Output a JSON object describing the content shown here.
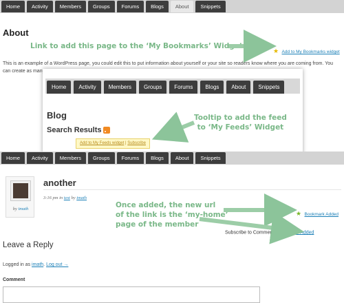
{
  "nav_tabs": [
    "Home",
    "Activity",
    "Members",
    "Groups",
    "Forums",
    "Blogs",
    "About",
    "Snippets"
  ],
  "active_tab": "About",
  "about_page": {
    "title": "About",
    "paragraph": "This is an example of a WordPress page, you could edit this to put information about yourself or your site so readers know where you are coming from. You can create as many pag"
  },
  "annotations": {
    "bookmark_link": "Link to add this page to the ‘My Bookmarks’ Widget",
    "tooltip_feed_line1": "Tooltip to add the feed",
    "tooltip_feed_line2": "to ‘My Feeds’ Widget",
    "once_added_line1": "Once added, the new url",
    "once_added_line2": "of the link is the ‘my-home’",
    "once_added_line3": "page of the member"
  },
  "bookmark_widget_link": "Add to My Bookmarks widget",
  "blog_panel": {
    "title": "Blog",
    "search_results": "Search Results",
    "tooltip_link": "Add to My Feeds widget",
    "tooltip_sep": "|",
    "tooltip_subscribe": "Subscribe"
  },
  "post": {
    "title": "another",
    "meta_time": "3:16 pm in ",
    "meta_category": "test",
    "meta_by": " by ",
    "meta_author": "imath",
    "byline_by": "by ",
    "byline_author": "imath",
    "bookmark_added": "Bookmark Added",
    "subscribe_to_comments": "Subscribe to Comments",
    "feed_added": "Feed Added"
  },
  "reply": {
    "heading": "Leave a Reply",
    "logged_in_prefix": "Logged in as ",
    "logged_in_user": "imath",
    "logout": "Log out →",
    "comment_label": "Comment"
  },
  "colors": {
    "nav_bg": "#d3d3d3",
    "tab_bg": "#3d3d3d",
    "annotation_green": "#7ab888",
    "link_blue": "#1a7fb7"
  }
}
